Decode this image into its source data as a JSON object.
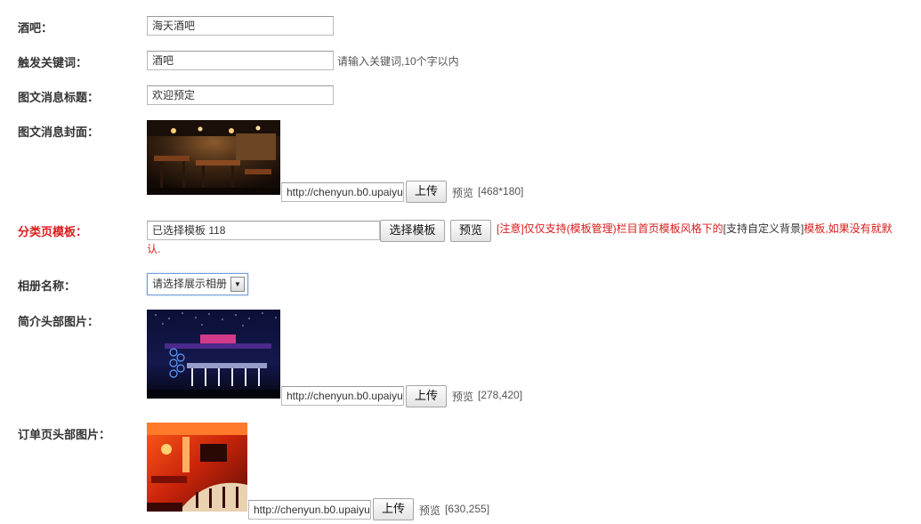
{
  "form": {
    "bar": {
      "label": "酒吧：",
      "value": "海天酒吧"
    },
    "keyword": {
      "label": "触发关键词：",
      "value": "酒吧",
      "hint": "请输入关键词,10个字以内"
    },
    "news_title": {
      "label": "图文消息标题：",
      "value": "欢迎预定"
    },
    "news_cover": {
      "label": "图文消息封面：",
      "url": "http://chenyun.b0.upaiyun",
      "upload_label": "上传",
      "preview_label": "预览",
      "size": "[468*180]"
    },
    "category_template": {
      "label": "分类页模板：",
      "value": "已选择模板 118",
      "choose_label": "选择模板",
      "preview_label": "预览",
      "notice_prefix": "[注意]仅仅支持(模板管理)栏目首页模板风格下的",
      "notice_highlight": "[支持自定义背景]",
      "notice_suffix": "模板,如果没有就默认."
    },
    "album": {
      "label": "相册名称：",
      "selected": "请选择展示相册"
    },
    "intro_header": {
      "label": "简介头部图片：",
      "url": "http://chenyun.b0.upaiyun",
      "upload_label": "上传",
      "preview_label": "预览",
      "size": "[278,420]"
    },
    "order_header": {
      "label": "订单页头部图片：",
      "url": "http://chenyun.b0.upaiyun",
      "upload_label": "上传",
      "preview_label": "预览",
      "size": "[630,255]"
    }
  },
  "colors": {
    "required_label": "#d91c1c",
    "notice": "#d91c1c"
  }
}
